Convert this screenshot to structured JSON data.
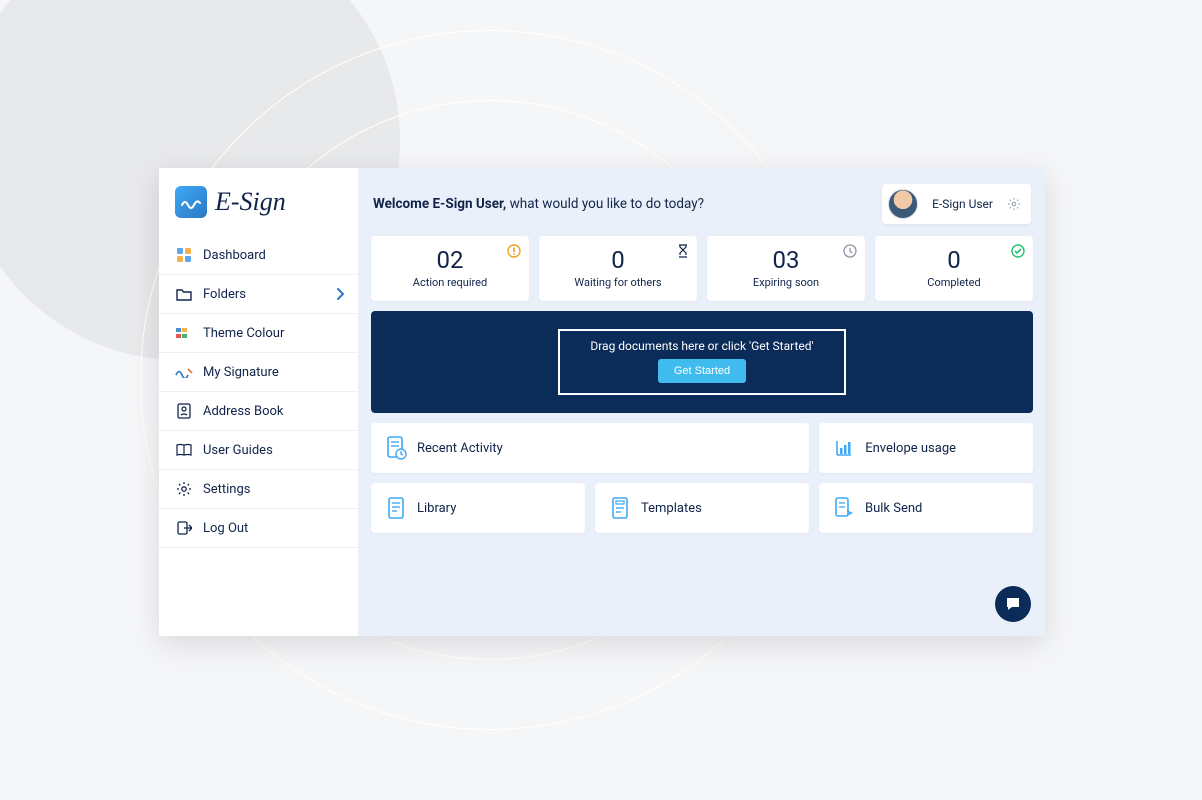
{
  "brand": {
    "name": "E-Sign",
    "mark": "m"
  },
  "sidebar": {
    "items": [
      {
        "label": "Dashboard",
        "icon": "dashboard"
      },
      {
        "label": "Folders",
        "icon": "folder",
        "expand": true
      },
      {
        "label": "Theme Colour",
        "icon": "theme"
      },
      {
        "label": "My Signature",
        "icon": "signature"
      },
      {
        "label": "Address Book",
        "icon": "address"
      },
      {
        "label": "User Guides",
        "icon": "guides"
      },
      {
        "label": "Settings",
        "icon": "settings"
      },
      {
        "label": "Log Out",
        "icon": "logout"
      }
    ]
  },
  "header": {
    "welcome_prefix": "Welcome E-Sign User,",
    "welcome_suffix": " what would you like to do today?",
    "user_name": "E-Sign User"
  },
  "stats": [
    {
      "num": "02",
      "label": "Action required",
      "icon": "alert",
      "color": "#f0a020"
    },
    {
      "num": "0",
      "label": "Waiting for others",
      "icon": "hourglass",
      "color": "#10244a"
    },
    {
      "num": "03",
      "label": "Expiring soon",
      "icon": "clock",
      "color": "#8a94a6"
    },
    {
      "num": "0",
      "label": "Completed",
      "icon": "check",
      "color": "#24c06b"
    }
  ],
  "upload": {
    "hint": "Drag documents here or click 'Get Started'",
    "button": "Get Started"
  },
  "cards": {
    "recent": "Recent Activity",
    "usage": "Envelope usage",
    "library": "Library",
    "templates": "Templates",
    "bulk": "Bulk Send"
  }
}
